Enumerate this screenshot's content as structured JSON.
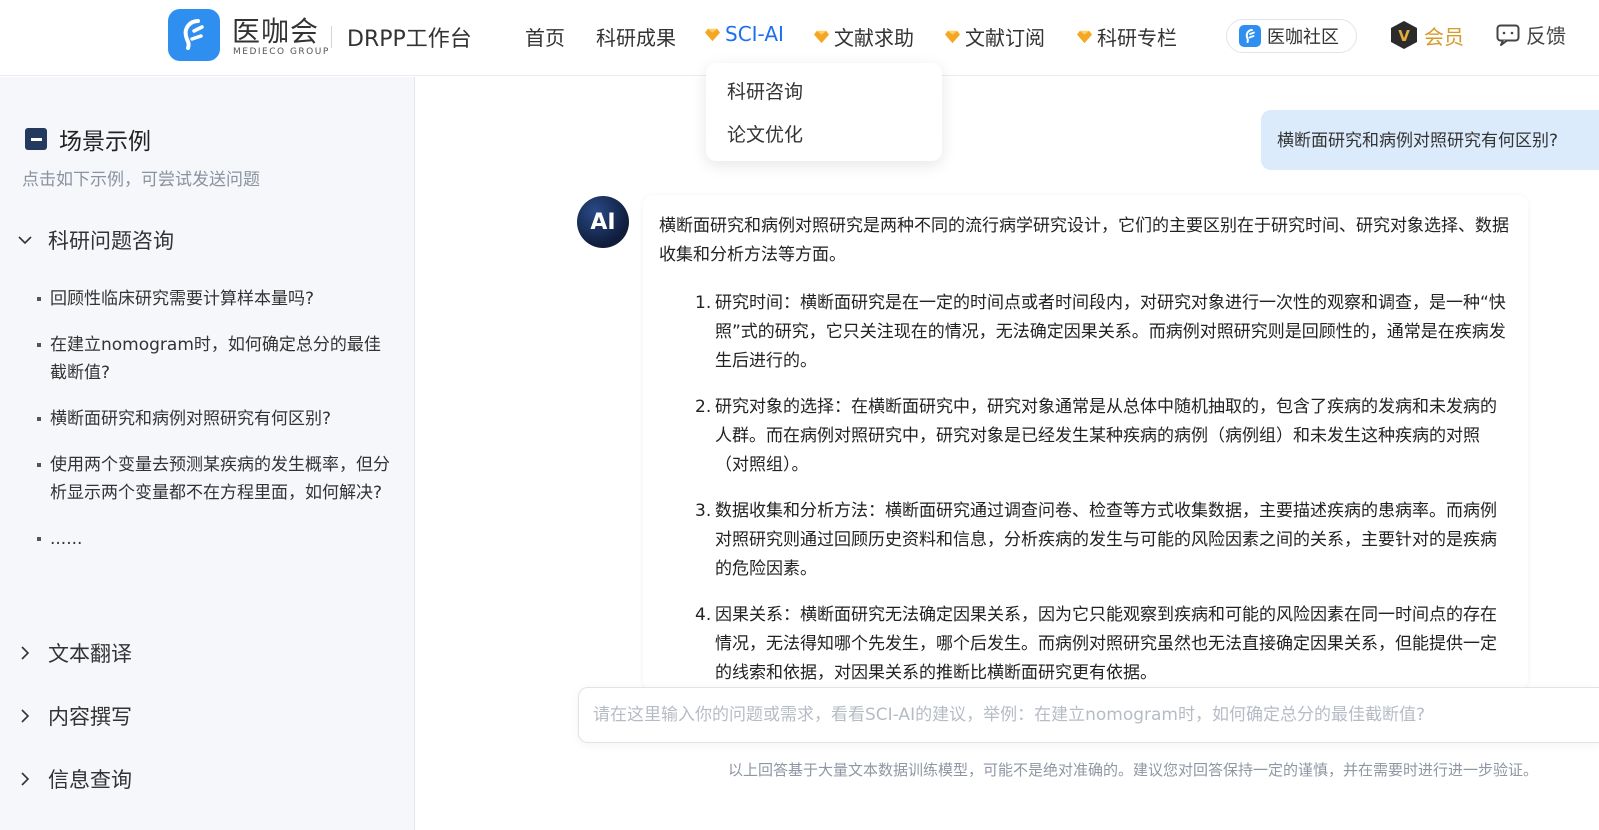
{
  "header": {
    "brand_cn": "医咖会",
    "brand_en": "MEDIECO GROUP",
    "workspace": "DRPP工作台",
    "nav": {
      "home": "首页",
      "research": "科研成果",
      "sciai": "SCI-AI",
      "docs": "文献求助",
      "subs": "文献订阅",
      "column": "科研专栏"
    },
    "community": "医咖社区",
    "member": "会员",
    "member_badge": "V",
    "feedback": "反馈",
    "accent_color": "#1c6ff0",
    "gem_color": "#f5a623"
  },
  "dropdown": {
    "items": [
      "科研咨询",
      "论文优化"
    ]
  },
  "sidebar": {
    "title": "场景示例",
    "subtitle": "点击如下示例，可尝试发送问题",
    "categories": [
      "科研问题咨询",
      "文本翻译",
      "内容撰写",
      "信息查询"
    ],
    "questions": [
      "回顾性临床研究需要计算样本量吗?",
      "在建立nomogram时，如何确定总分的最佳截断值?",
      "横断面研究和病例对照研究有何区别?",
      "使用两个变量去预测某疾病的发生概率，但分析显示两个变量都不在方程里面，如何解决?",
      "......"
    ]
  },
  "chat": {
    "user_message": "横断面研究和病例对照研究有何区别?",
    "ai_avatar_label": "AI",
    "ai_intro": "横断面研究和病例对照研究是两种不同的流行病学研究设计，它们的主要区别在于研究时间、研究对象选择、数据收集和分析方法等方面。",
    "ai_points": [
      {
        "num": "1.",
        "text": "研究时间：横断面研究是在一定的时间点或者时间段内，对研究对象进行一次性的观察和调查，是一种“快照”式的研究，它只关注现在的情况，无法确定因果关系。而病例对照研究则是回顾性的，通常是在疾病发生后进行的。"
      },
      {
        "num": "2.",
        "text": "研究对象的选择：在横断面研究中，研究对象通常是从总体中随机抽取的，包含了疾病的发病和未发病的人群。而在病例对照研究中，研究对象是已经发生某种疾病的病例（病例组）和未发生这种疾病的对照（对照组）。"
      },
      {
        "num": "3.",
        "text": "数据收集和分析方法：横断面研究通过调查问卷、检查等方式收集数据，主要描述疾病的患病率。而病例对照研究则通过回顾历史资料和信息，分析疾病的发生与可能的风险因素之间的关系，主要针对的是疾病的危险因素。"
      },
      {
        "num": "4.",
        "text": "因果关系：横断面研究无法确定因果关系，因为它只能观察到疾病和可能的风险因素在同一时间点的存在情况，无法得知哪个先发生，哪个后发生。而病例对照研究虽然也无法直接确定因果关系，但能提供一定的线索和依据，对因果关系的推断比横断面研究更有依据。"
      }
    ],
    "input_placeholder": "请在这里输入你的问题或需求，看看SCI-AI的建议，举例：在建立nomogram时，如何确定总分的最佳截断值?",
    "input_value": "",
    "disclaimer": "以上回答基于大量文本数据训练模型，可能不是绝对准确的。建议您对回答保持一定的谨慎，并在需要时进行进一步验证。"
  }
}
